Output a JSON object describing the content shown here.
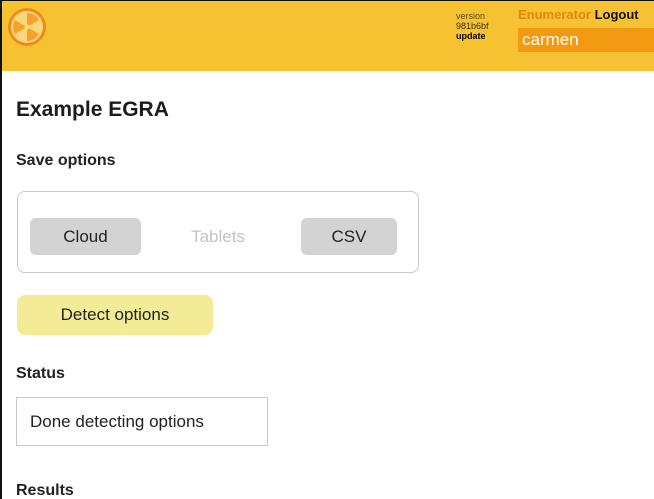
{
  "header": {
    "logo_icon": "orange-slice-icon",
    "version_label": "version",
    "version_hash": "981b6bf",
    "update_label": "update",
    "enumerator_label": "Enumerator",
    "logout_label": "Logout",
    "user_name": "carmen",
    "colors": {
      "bar": "#f6c232",
      "accent": "#f29a12"
    }
  },
  "main": {
    "title": "Example EGRA",
    "save_options": {
      "label": "Save options",
      "options": [
        {
          "label": "Cloud",
          "enabled": true
        },
        {
          "label": "Tablets",
          "enabled": false
        },
        {
          "label": "CSV",
          "enabled": true
        }
      ]
    },
    "detect_button_label": "Detect options",
    "status": {
      "label": "Status",
      "value": "Done detecting options"
    },
    "results_label": "Results"
  }
}
